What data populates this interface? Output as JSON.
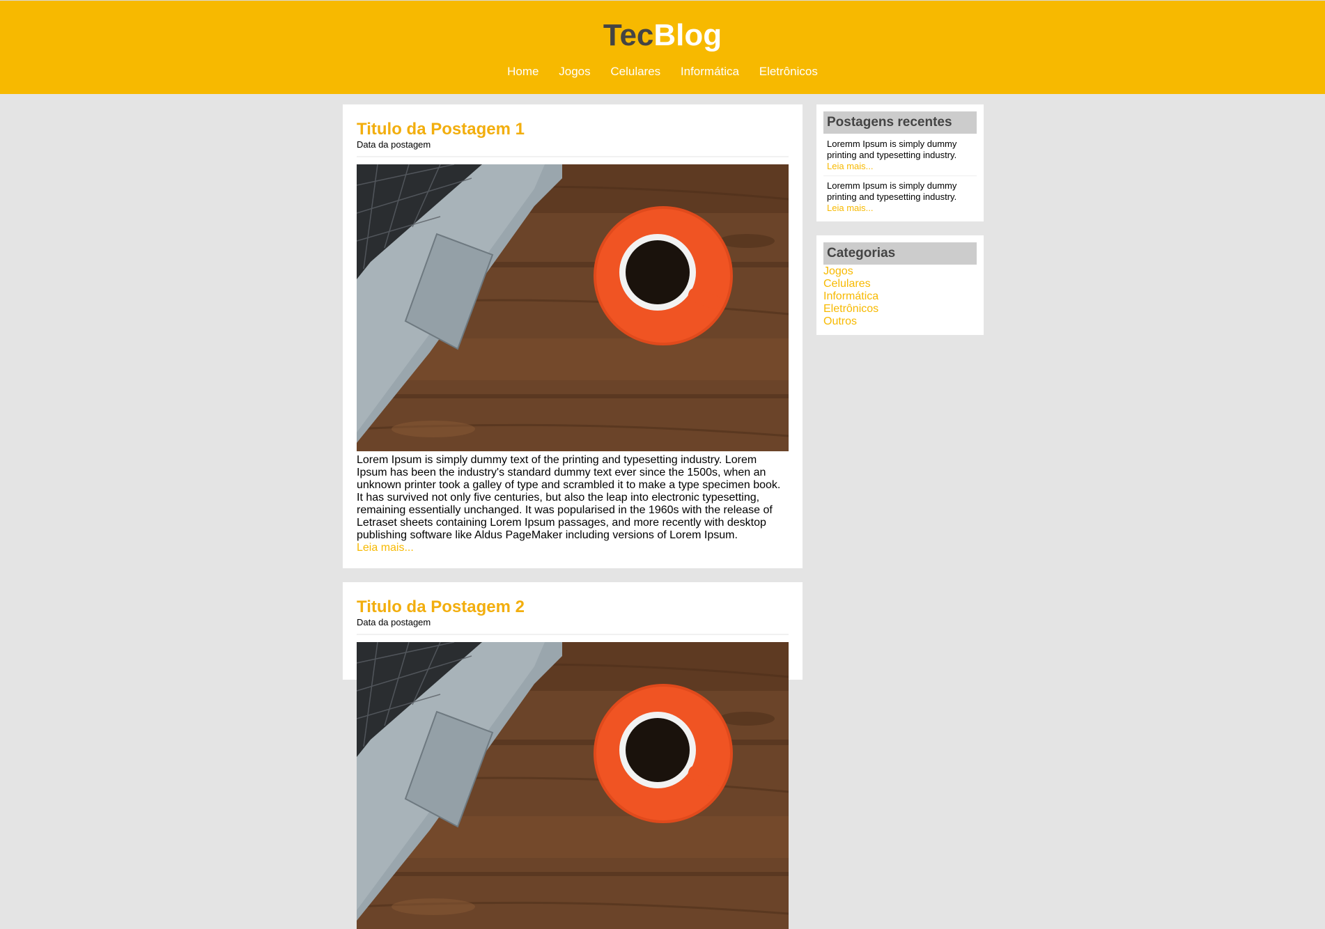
{
  "brand": {
    "part1": "Tec",
    "part2": "Blog",
    "accent": "#f7b900"
  },
  "nav": [
    {
      "label": "Home"
    },
    {
      "label": "Jogos"
    },
    {
      "label": "Celulares"
    },
    {
      "label": "Informática"
    },
    {
      "label": "Eletrônicos"
    }
  ],
  "posts": [
    {
      "title": "Titulo da Postagem 1",
      "date": "Data da postagem",
      "image": "laptop-and-coffee-photo",
      "text": "Lorem Ipsum is simply dummy text of the printing and typesetting industry. Lorem Ipsum has been the industry's standard dummy text ever since the 1500s, when an unknown printer took a galley of type and scrambled it to make a type specimen book. It has survived not only five centuries, but also the leap into electronic typesetting, remaining essentially unchanged. It was popularised in the 1960s with the release of Letraset sheets containing Lorem Ipsum passages, and more recently with desktop publishing software like Aldus PageMaker including versions of Lorem Ipsum.",
      "more": "Leia mais..."
    },
    {
      "title": "Titulo da Postagem 2",
      "date": "Data da postagem",
      "image": "laptop-and-coffee-photo"
    }
  ],
  "sidebar": {
    "recent": {
      "title": "Postagens recentes",
      "items": [
        {
          "text": "Loremm Ipsum is simply dummy printing and typesetting industry.",
          "more": "Leia mais..."
        },
        {
          "text": "Loremm Ipsum is simply dummy printing and typesetting industry.",
          "more": "Leia mais..."
        }
      ]
    },
    "categories": {
      "title": "Categorias",
      "items": [
        "Jogos",
        "Celulares",
        "Informática",
        "Eletrônicos",
        "Outros"
      ]
    }
  }
}
